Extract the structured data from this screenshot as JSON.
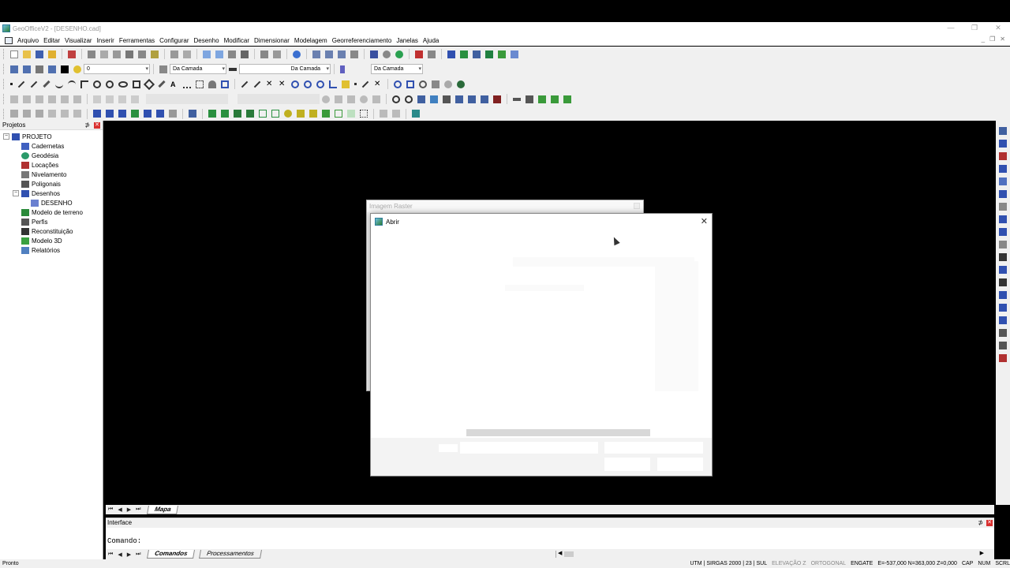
{
  "window": {
    "title": "GeoOfficeV2 - [DESENHO.cad]",
    "controls": [
      "—",
      "❐",
      "✕"
    ]
  },
  "menu": [
    "Arquivo",
    "Editar",
    "Visualizar",
    "Inserir",
    "Ferramentas",
    "Configurar",
    "Desenho",
    "Modificar",
    "Dimensionar",
    "Modelagem",
    "Georreferenciamento",
    "Janelas",
    "Ajuda"
  ],
  "mdi_controls": [
    "_",
    "❐",
    "✕"
  ],
  "layer_toolbar": {
    "layer_value": "0",
    "color_value": "Da Camada",
    "linetype_value": "Da Camada",
    "lineweight_value": "Da Camada"
  },
  "projects_panel": {
    "title": "Projetos",
    "pin": "⊅",
    "close": "✕",
    "tree": [
      {
        "label": "PROJETO",
        "level": 0,
        "expander": "−",
        "icon": "project-icon"
      },
      {
        "label": "Cadernetas",
        "level": 1,
        "icon": "notebook-icon"
      },
      {
        "label": "Geodésia",
        "level": 1,
        "icon": "globe-icon"
      },
      {
        "label": "Locações",
        "level": 1,
        "icon": "location-icon"
      },
      {
        "label": "Nivelamento",
        "level": 1,
        "icon": "level-icon"
      },
      {
        "label": "Poligonais",
        "level": 1,
        "icon": "polygon-icon"
      },
      {
        "label": "Desenhos",
        "level": 1,
        "expander": "−",
        "icon": "drawings-icon"
      },
      {
        "label": "DESENHO",
        "level": 2,
        "icon": "drawing-icon"
      },
      {
        "label": "Modelo de terreno",
        "level": 1,
        "icon": "terrain-icon"
      },
      {
        "label": "Perfis",
        "level": 1,
        "icon": "profile-icon"
      },
      {
        "label": "Reconstituição",
        "level": 1,
        "icon": "reconstruction-icon"
      },
      {
        "label": "Modelo 3D",
        "level": 1,
        "icon": "model-3d-icon"
      },
      {
        "label": "Relatórios",
        "level": 1,
        "icon": "reports-icon"
      }
    ]
  },
  "drawing_tabs": {
    "nav": [
      "⏮",
      "◀",
      "▶",
      "⏭"
    ],
    "active": "Mapa"
  },
  "interface_panel": {
    "title": "Interface",
    "pin": "⊅",
    "close": "✕",
    "command_prompt": "Comando:",
    "tabs": [
      "Comandos",
      "Processamentos"
    ],
    "nav": [
      "⏮",
      "◀",
      "▶",
      "⏭"
    ],
    "scroll_arrows": [
      "◀",
      "▶"
    ]
  },
  "status_bar": {
    "left": "Pronto",
    "projection": "UTM | SIRGAS 2000 | 23 | SUL",
    "elevation": "ELEVAÇÃO Z",
    "orthogonal": "ORTOGONAL",
    "snap": "ENGATE",
    "coordinates": "E=-537,000 N=363,000 Z=0,000",
    "caps": "CAP",
    "num": "NUM",
    "scrl": "SCRL"
  },
  "raster_window": {
    "title": "Imagem Raster"
  },
  "open_dialog": {
    "title": "Abrir",
    "close": "✕"
  }
}
